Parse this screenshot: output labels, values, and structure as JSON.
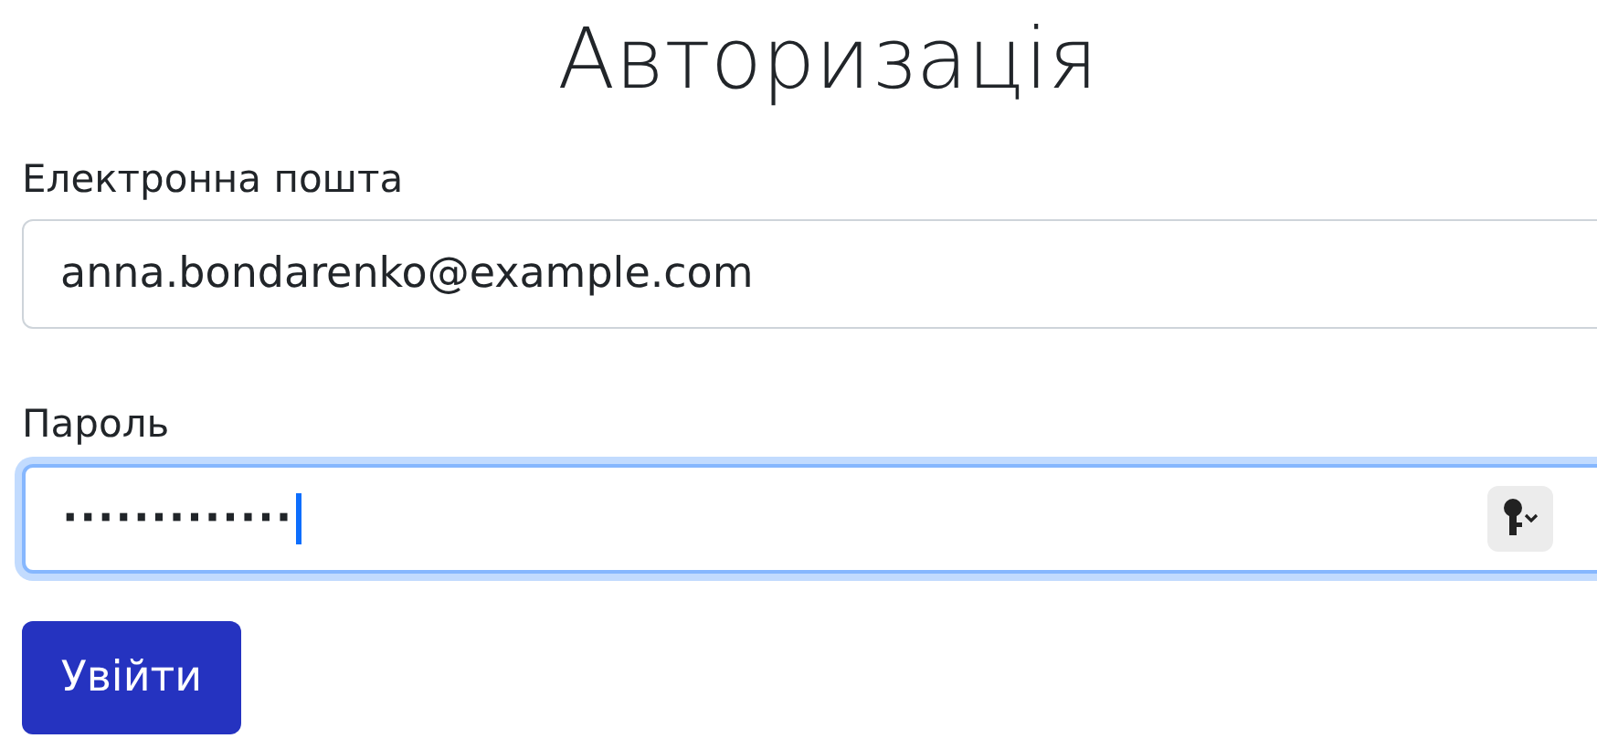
{
  "title": "Авторизація",
  "email": {
    "label": "Електронна пошта",
    "value": "anna.bondarenko@example.com",
    "focused": false
  },
  "password": {
    "label": "Пароль",
    "value": "·············",
    "focused": true
  },
  "submit": {
    "label": "Увійти"
  }
}
